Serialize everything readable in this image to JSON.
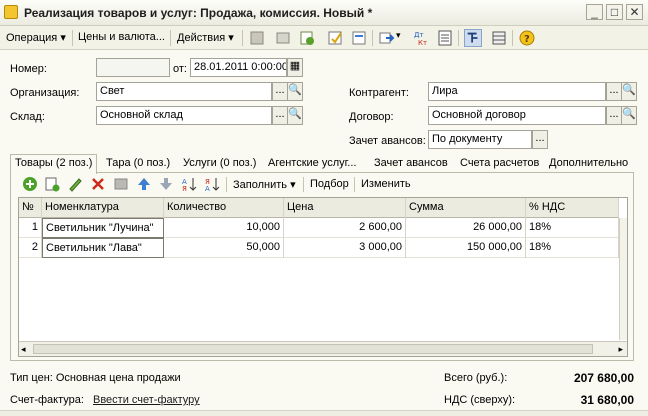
{
  "window": {
    "title": "Реализация товаров и услуг: Продажа, комиссия. Новый *",
    "minimize": "_",
    "maximize": "□",
    "close": "✕"
  },
  "toolbar": {
    "operation": "Операция",
    "prices": "Цены и валюта...",
    "actions": "Действия"
  },
  "form": {
    "number_label": "Номер:",
    "number_value": "",
    "date_label": "от:",
    "date_value": "28.01.2011  0:00:00",
    "org_label": "Организация:",
    "org_value": "Свет",
    "warehouse_label": "Склад:",
    "warehouse_value": "Основной склад",
    "contractor_label": "Контрагент:",
    "contractor_value": "Лира",
    "contract_label": "Договор:",
    "contract_value": "Основной договор",
    "advance_label": "Зачет авансов:",
    "advance_value": "По документу",
    "select_btn": "...",
    "open_btn": "🔍"
  },
  "tabs": [
    {
      "label": "Товары (2 поз.)"
    },
    {
      "label": "Тара (0 поз.)"
    },
    {
      "label": "Услуги (0 поз.)"
    },
    {
      "label": "Агентские услуг..."
    },
    {
      "label": "Зачет авансов"
    },
    {
      "label": "Счета расчетов"
    },
    {
      "label": "Дополнительно"
    }
  ],
  "table_toolbar": {
    "fill": "Заполнить",
    "select": "Подбор",
    "change": "Изменить"
  },
  "table": {
    "columns": [
      "№",
      "Номенклатура",
      "Количество",
      "Цена",
      "Сумма",
      "% НДС"
    ],
    "rows": [
      [
        "1",
        "Светильник \"Лучина\"",
        "10,000",
        "2 600,00",
        "26 000,00",
        "18%"
      ],
      [
        "2",
        "Светильник \"Лава\"",
        "50,000",
        "3 000,00",
        "150 000,00",
        "18%"
      ]
    ]
  },
  "footer": {
    "price_type": "Тип цен: Основная цена продажи",
    "invoice_label": "Счет-фактура:",
    "invoice_link": "Ввести счет-фактуру",
    "total_label": "Всего (руб.):",
    "total_value": "207 680,00",
    "vat_label": "НДС (сверху):",
    "vat_value": "31 680,00"
  }
}
